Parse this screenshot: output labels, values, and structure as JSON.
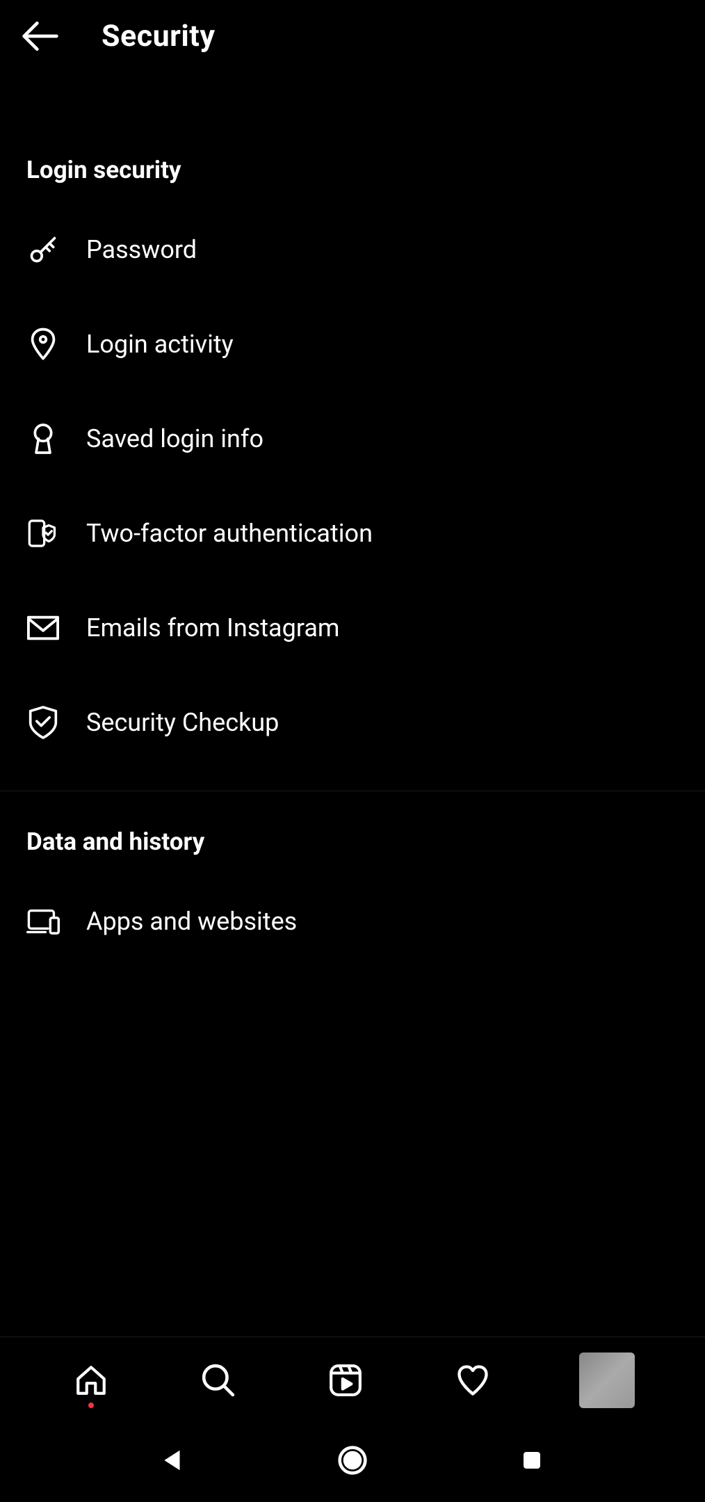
{
  "header": {
    "title": "Security"
  },
  "sections": [
    {
      "title": "Login security",
      "items": [
        {
          "label": "Password",
          "icon": "key"
        },
        {
          "label": "Login activity",
          "icon": "location"
        },
        {
          "label": "Saved login info",
          "icon": "keyhole"
        },
        {
          "label": "Two-factor authentication",
          "icon": "device-shield"
        },
        {
          "label": "Emails from Instagram",
          "icon": "mail"
        },
        {
          "label": "Security Checkup",
          "icon": "shield-check"
        }
      ]
    },
    {
      "title": "Data and history",
      "items": [
        {
          "label": "Apps and websites",
          "icon": "devices"
        }
      ]
    }
  ]
}
